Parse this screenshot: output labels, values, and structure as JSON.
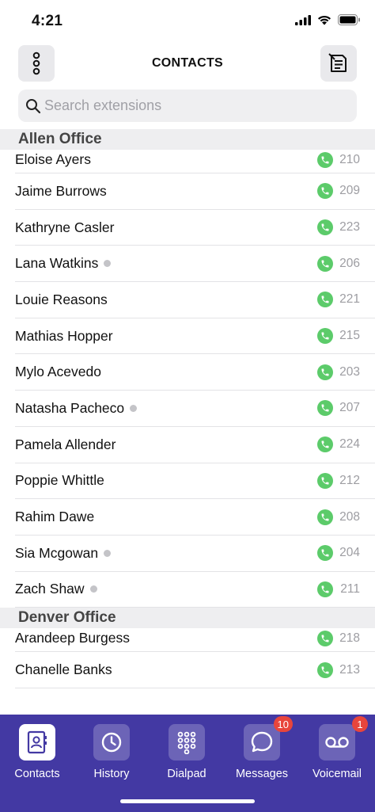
{
  "status_bar": {
    "time": "4:21"
  },
  "header": {
    "title": "CONTACTS"
  },
  "search": {
    "placeholder": "Search extensions",
    "value": ""
  },
  "sections": [
    {
      "name": "Allen Office",
      "contacts": [
        {
          "name": "Eloise Ayers",
          "ext": "210",
          "presence": false
        },
        {
          "name": "Jaime Burrows",
          "ext": "209",
          "presence": false
        },
        {
          "name": "Kathryne Casler",
          "ext": "223",
          "presence": false
        },
        {
          "name": "Lana Watkins",
          "ext": "206",
          "presence": true
        },
        {
          "name": "Louie Reasons",
          "ext": "221",
          "presence": false
        },
        {
          "name": "Mathias Hopper",
          "ext": "215",
          "presence": false
        },
        {
          "name": "Mylo Acevedo",
          "ext": "203",
          "presence": false
        },
        {
          "name": "Natasha Pacheco",
          "ext": "207",
          "presence": true
        },
        {
          "name": "Pamela Allender",
          "ext": "224",
          "presence": false
        },
        {
          "name": "Poppie Whittle",
          "ext": "212",
          "presence": false
        },
        {
          "name": "Rahim Dawe",
          "ext": "208",
          "presence": false
        },
        {
          "name": "Sia Mcgowan",
          "ext": "204",
          "presence": true
        },
        {
          "name": "Zach Shaw",
          "ext": "211",
          "presence": true
        }
      ]
    },
    {
      "name": "Denver Office",
      "contacts": [
        {
          "name": "Arandeep Burgess",
          "ext": "218",
          "presence": false
        },
        {
          "name": "Chanelle Banks",
          "ext": "213",
          "presence": false
        }
      ]
    }
  ],
  "tabs": [
    {
      "label": "Contacts",
      "icon": "contacts-icon",
      "active": true,
      "badge": ""
    },
    {
      "label": "History",
      "icon": "clock-icon",
      "active": false,
      "badge": ""
    },
    {
      "label": "Dialpad",
      "icon": "dialpad-icon",
      "active": false,
      "badge": ""
    },
    {
      "label": "Messages",
      "icon": "chat-bubble-icon",
      "active": false,
      "badge": "10"
    },
    {
      "label": "Voicemail",
      "icon": "voicemail-icon",
      "active": false,
      "badge": "1"
    }
  ],
  "colors": {
    "accent": "#4339a3",
    "call_green": "#5ccb6a",
    "badge_red": "#e8453c",
    "presence_grey": "#c4c4c8"
  }
}
